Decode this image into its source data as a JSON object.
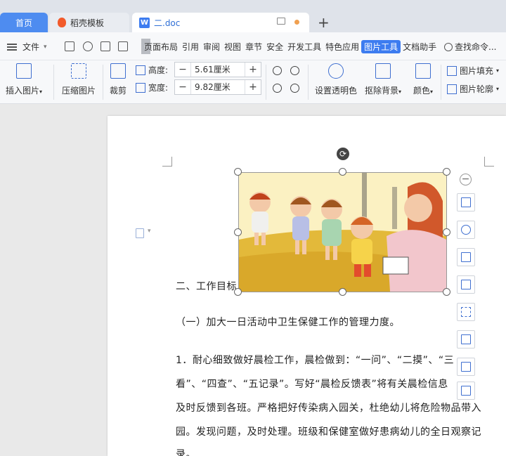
{
  "tabs": {
    "home": "首页",
    "docer": "稻壳模板",
    "doc": "二.doc",
    "new_tab": "+"
  },
  "menu": {
    "file": "文件",
    "items": [
      "页面布局",
      "引用",
      "审阅",
      "视图",
      "章节",
      "安全",
      "开发工具",
      "特色应用",
      "图片工具",
      "文档助手"
    ],
    "active_index": 8,
    "search": "查找命令..."
  },
  "ribbon": {
    "insert_picture": "插入图片",
    "compress_picture": "压缩图片",
    "crop": "裁剪",
    "height_label": "高度:",
    "height_value": "5.61厘米",
    "width_label": "宽度:",
    "width_value": "9.82厘米",
    "transparent": "设置透明色",
    "remove_bg": "抠除背景",
    "color": "颜色",
    "picture_fill": "图片填充",
    "picture_outline": "图片轮廓"
  },
  "document": {
    "line1": "二、工作目标",
    "line2": "（一）加大一日活动中卫生保健工作的管理力度。",
    "line3": "1．耐心细致做好晨检工作，晨检做到：“一问”、“二摸”、“三",
    "line4": "看”、“四查”、“五记录”。写好“晨检反馈表”将有关晨检信息",
    "line5": "及时反馈到各班。严格把好传染病入园关，杜绝幼儿将危险物品带入",
    "line6": "园。发现问题，及时处理。班级和保健室做好患病幼儿的全日观察记",
    "line7": "录。"
  },
  "colors": {
    "accent": "#3d7cf0",
    "tab_home": "#4e8cf0"
  }
}
